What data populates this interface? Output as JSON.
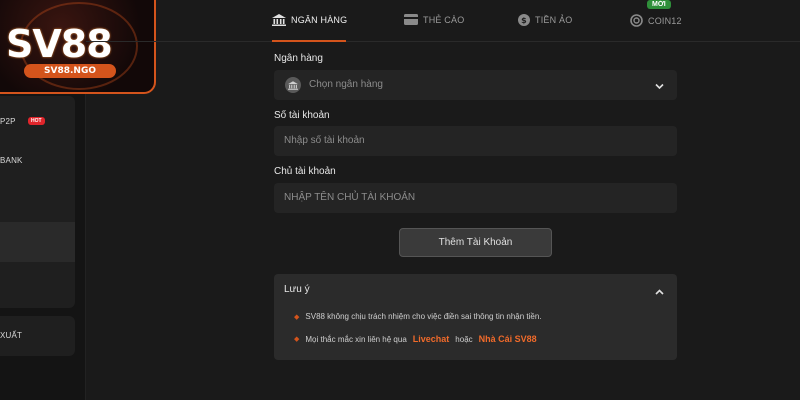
{
  "brand": {
    "logo_text": "SV88",
    "logo_domain": "SV88.NGO"
  },
  "sidebar": {
    "items": [
      {
        "label": "P2P",
        "badge": "HOT"
      },
      {
        "label": "BANK"
      },
      {
        "label": "XUẤT"
      }
    ]
  },
  "tabs": [
    {
      "label": "NGÂN HÀNG",
      "icon": "bank-icon",
      "active": true
    },
    {
      "label": "THẺ CÀO",
      "icon": "card-icon",
      "active": false
    },
    {
      "label": "TIỀN ẢO",
      "icon": "crypto-icon",
      "active": false
    },
    {
      "label": "COIN12",
      "icon": "coin12-icon",
      "active": false,
      "badge": "MỚI"
    }
  ],
  "form": {
    "bank": {
      "label": "Ngân hàng",
      "placeholder": "Chọn ngân hàng"
    },
    "account_number": {
      "label": "Số tài khoản",
      "placeholder": "Nhập số tài khoản"
    },
    "account_holder": {
      "label": "Chủ tài khoản",
      "placeholder": "NHẬP TÊN CHỦ TÀI KHOẢN"
    },
    "submit_label": "Thêm Tài Khoản"
  },
  "note": {
    "title": "Lưu ý",
    "line1": "SV88 không chịu trách nhiệm cho việc điền sai thông tin nhận tiền.",
    "line2_prefix": "Mọi thắc mắc xin liên hệ qua",
    "line2_link1": "Livechat",
    "line2_mid": "hoặc",
    "line2_link2": "Nhà Cái SV88"
  },
  "colors": {
    "accent": "#d4541c",
    "highlight": "#f06a2a",
    "new_badge": "#2f8f3a",
    "hot_badge": "#e0252b"
  }
}
